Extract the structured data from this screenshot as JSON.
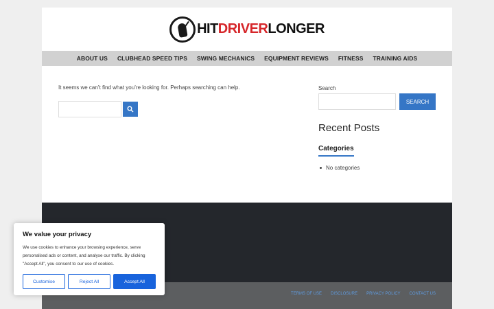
{
  "header": {
    "logo_hit": "HIT",
    "logo_driver": "DRIVER",
    "logo_longer": "LONGER",
    "brand_color": "#d6262a"
  },
  "nav": {
    "items": [
      {
        "label": "ABOUT US"
      },
      {
        "label": "CLUBHEAD SPEED TIPS"
      },
      {
        "label": "SWING MECHANICS"
      },
      {
        "label": "EQUIPMENT REVIEWS"
      },
      {
        "label": "FITNESS"
      },
      {
        "label": "TRAINING AIDS"
      }
    ]
  },
  "main": {
    "not_found_text": "It seems we can’t find what you’re looking for. Perhaps searching can help.",
    "search_value": "",
    "search_icon": "search-icon"
  },
  "sidebar": {
    "search_label": "Search",
    "search_value": "",
    "search_button": "SEARCH",
    "recent_posts_title": "Recent Posts",
    "categories_title": "Categories",
    "categories_items": [
      "No categories"
    ]
  },
  "footer": {
    "links": [
      {
        "label": "TERMS OF USE"
      },
      {
        "label": "DISCLOSURE"
      },
      {
        "label": "PRIVACY POLICY"
      },
      {
        "label": "CONTACT US"
      }
    ]
  },
  "cookie_banner": {
    "title": "We value your privacy",
    "text": "We use cookies to enhance your browsing experience, serve personalised ads or content, and analyse our traffic. By clicking \"Accept All\", you consent to our use of cookies.",
    "customise_label": "Customise",
    "reject_label": "Reject All",
    "accept_label": "Accept All",
    "accent_color": "#1863dc"
  },
  "colors": {
    "accent": "#3576c6",
    "nav_bg": "#d1d1d1",
    "footer_dark": "#24272c",
    "footer_grey": "#5c5e60"
  }
}
